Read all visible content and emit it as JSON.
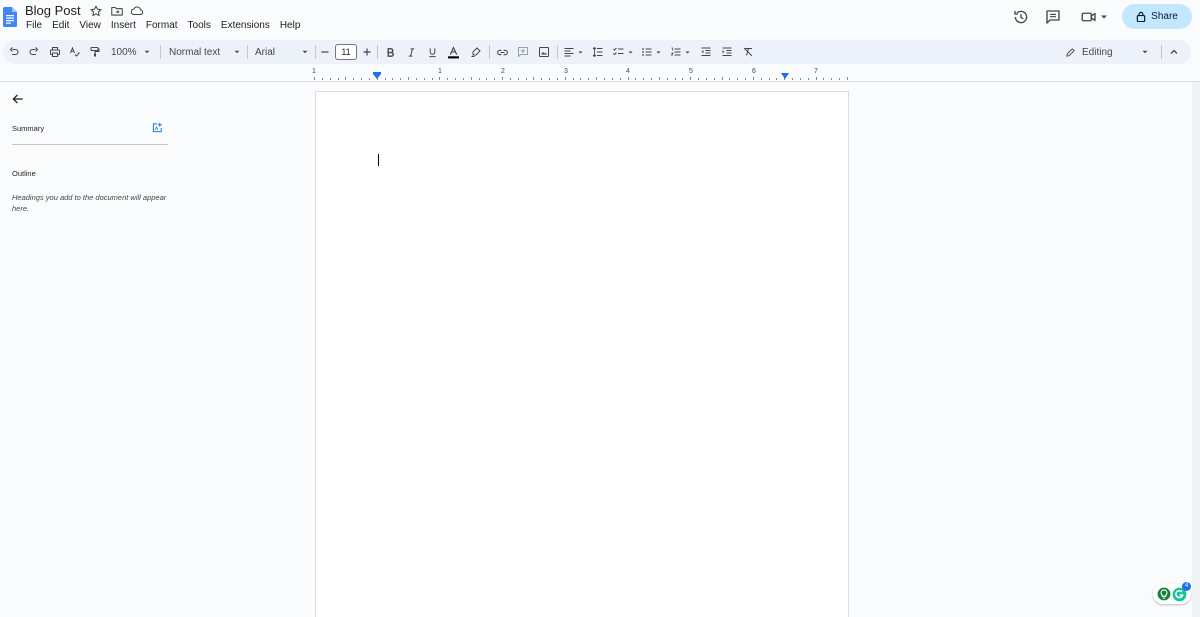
{
  "app": {
    "doc_title": "Blog Post",
    "menus": [
      "File",
      "Edit",
      "View",
      "Insert",
      "Format",
      "Tools",
      "Extensions",
      "Help"
    ],
    "share_label": "Share"
  },
  "toolbar": {
    "zoom": "100%",
    "style": "Normal text",
    "font": "Arial",
    "font_size": "11",
    "mode": "Editing"
  },
  "ruler": {
    "labels": [
      "1",
      "1",
      "2",
      "3",
      "4",
      "5",
      "6",
      "7"
    ]
  },
  "sidebar": {
    "summary_label": "Summary",
    "outline_label": "Outline",
    "outline_hint": "Headings you add to the document will appear here."
  },
  "badge": {
    "count": "4"
  },
  "colors": {
    "accent": "#1a73e8",
    "share_bg": "#c2e7ff",
    "toolbar_bg": "#edf2fa",
    "page_bg": "#f9fbfd"
  }
}
